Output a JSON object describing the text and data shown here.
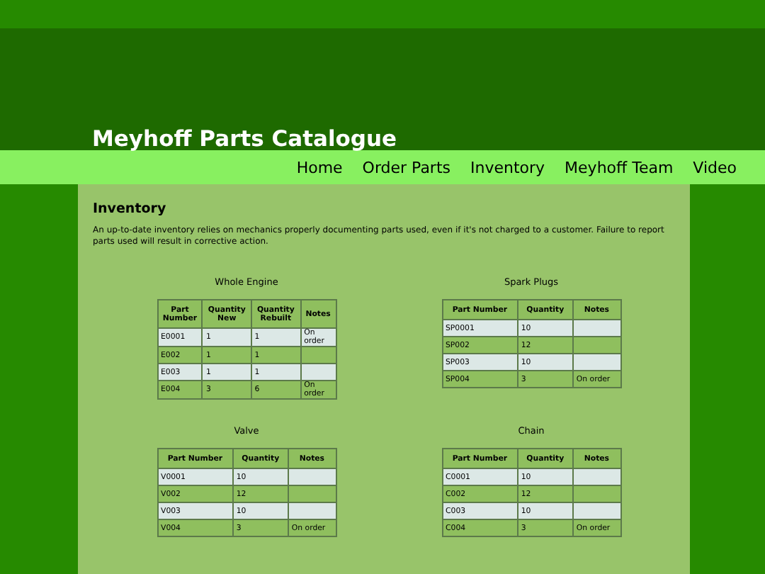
{
  "site_title": "Meyhoff Parts Catalogue",
  "nav": [
    {
      "label": "Home"
    },
    {
      "label": "Order Parts"
    },
    {
      "label": "Inventory"
    },
    {
      "label": "Meyhoff Team"
    },
    {
      "label": "Video"
    }
  ],
  "heading": "Inventory",
  "intro": "An up-to-date inventory relies on mechanics properly documenting parts used, even if it's not charged to a customer. Failure to report parts used will result in corrective action.",
  "tables": [
    {
      "caption": "Whole Engine",
      "columns": [
        "Part Number",
        "Quantity New",
        "Quantity Rebuilt",
        "Notes"
      ],
      "rows": [
        [
          "E0001",
          "1",
          "1",
          "On order"
        ],
        [
          "E002",
          "1",
          "1",
          ""
        ],
        [
          "E003",
          "1",
          "1",
          ""
        ],
        [
          "E004",
          "3",
          "6",
          "On order"
        ]
      ]
    },
    {
      "caption": "Spark Plugs",
      "columns": [
        "Part Number",
        "Quantity",
        "Notes"
      ],
      "rows": [
        [
          "SP0001",
          "10",
          ""
        ],
        [
          "SP002",
          "12",
          ""
        ],
        [
          "SP003",
          "10",
          ""
        ],
        [
          "SP004",
          "3",
          "On order"
        ]
      ]
    },
    {
      "caption": "Valve",
      "columns": [
        "Part Number",
        "Quantity",
        "Notes"
      ],
      "rows": [
        [
          "V0001",
          "10",
          ""
        ],
        [
          "V002",
          "12",
          ""
        ],
        [
          "V003",
          "10",
          ""
        ],
        [
          "V004",
          "3",
          "On order"
        ]
      ]
    },
    {
      "caption": "Chain",
      "columns": [
        "Part Number",
        "Quantity",
        "Notes"
      ],
      "rows": [
        [
          "C0001",
          "10",
          ""
        ],
        [
          "C002",
          "12",
          ""
        ],
        [
          "C003",
          "10",
          ""
        ],
        [
          "C004",
          "3",
          "On order"
        ]
      ]
    }
  ]
}
